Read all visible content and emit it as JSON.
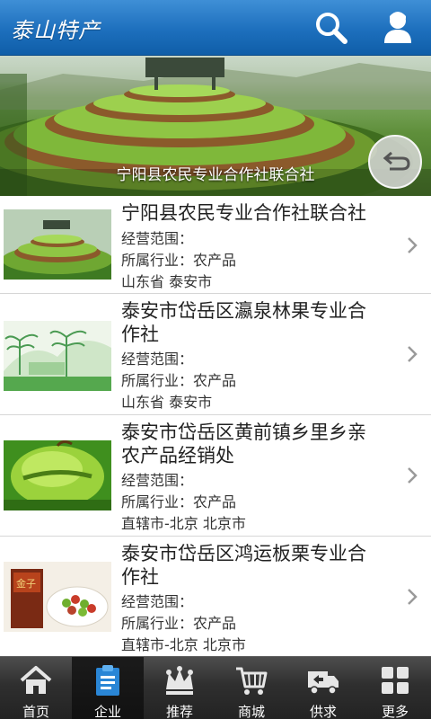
{
  "header": {
    "title": "泰山特产",
    "search_icon": "search-icon",
    "user_icon": "user-icon"
  },
  "banner": {
    "caption": "宁阳县农民专业合作社联合社",
    "back_icon": "back-arrow-icon"
  },
  "list": {
    "items": [
      {
        "title_lines": [
          "宁阳县农民专业合作社联合社"
        ],
        "scope": "经营范围：",
        "industry": "所属行业：农产品",
        "location": "山东省  泰安市"
      },
      {
        "title_lines": [
          "泰安市岱岳区瀛泉林果专业合",
          "作社"
        ],
        "scope": "经营范围：",
        "industry": "所属行业：农产品",
        "location": "山东省  泰安市"
      },
      {
        "title_lines": [
          "泰安市岱岳区黄前镇乡里乡亲",
          "农产品经销处"
        ],
        "scope": "经营范围：",
        "industry": "所属行业：农产品",
        "location": "直辖市-北京  北京市"
      },
      {
        "title_lines": [
          "泰安市岱岳区鸿运板栗专业合",
          "作社"
        ],
        "scope": "经营范围：",
        "industry": "所属行业：农产品",
        "location": "直辖市-北京  北京市"
      }
    ]
  },
  "thumb4_text": "金子",
  "nav": {
    "active_index": 1,
    "items": [
      {
        "label": "首页",
        "icon": "home-icon"
      },
      {
        "label": "企业",
        "icon": "clipboard-icon"
      },
      {
        "label": "推荐",
        "icon": "crown-icon"
      },
      {
        "label": "商城",
        "icon": "cart-icon"
      },
      {
        "label": "供求",
        "icon": "truck-icon"
      },
      {
        "label": "更多",
        "icon": "grid-icon"
      }
    ]
  },
  "colors": {
    "header_top": "#3f8fd6",
    "header_bottom": "#0f5ea8",
    "nav_bg": "#2f2f2f",
    "active_icon": "#2a86d6"
  }
}
